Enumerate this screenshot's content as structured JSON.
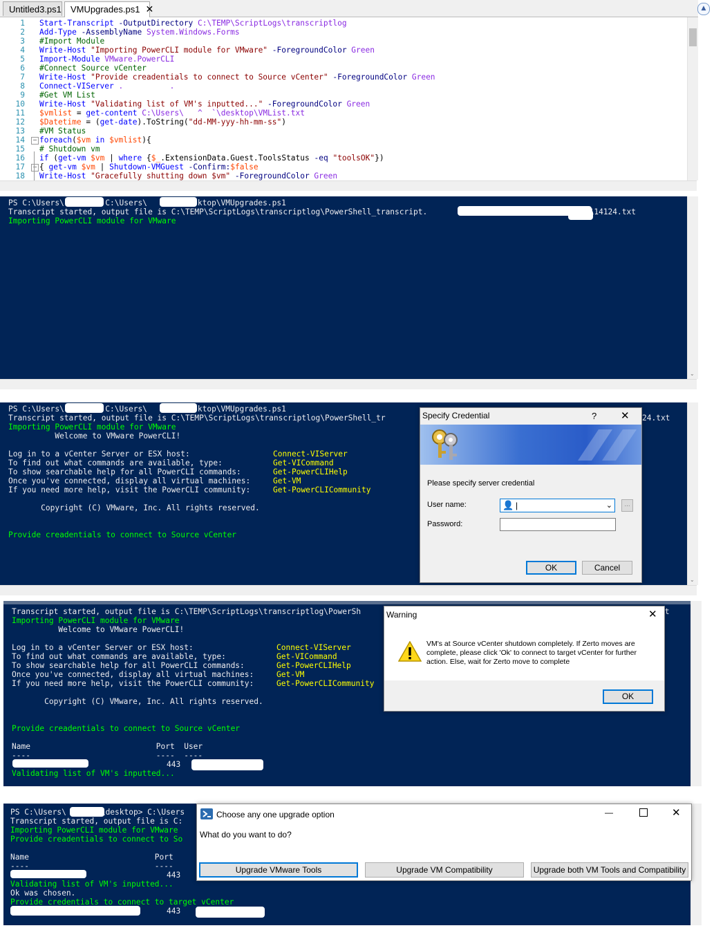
{
  "editor": {
    "tabs": [
      {
        "label": "Untitled3.ps1"
      },
      {
        "label": "VMUpgrades.ps1",
        "close": "✕"
      }
    ],
    "lines": [
      {
        "n": "1",
        "parts": [
          [
            "c",
            "Start-Transcript"
          ],
          [
            "p",
            " -OutputDirectory "
          ],
          [
            "a",
            "C:\\TEMP\\ScriptLogs\\transcriptlog"
          ]
        ]
      },
      {
        "n": "2",
        "parts": [
          [
            "c",
            "Add-Type"
          ],
          [
            "p",
            " -AssemblyName "
          ],
          [
            "a",
            "System.Windows.Forms"
          ]
        ]
      },
      {
        "n": "3",
        "parts": [
          [
            "m",
            "#Import Module"
          ]
        ]
      },
      {
        "n": "4",
        "parts": [
          [
            "c",
            "Write-Host"
          ],
          [
            "s",
            " \"Importing PowerCLI module for VMware\""
          ],
          [
            "p",
            " -ForegroundColor "
          ],
          [
            "a",
            "Green"
          ]
        ]
      },
      {
        "n": "5",
        "parts": [
          [
            "c",
            "Import-Module"
          ],
          [
            "a",
            " VMware.PowerCLI"
          ]
        ]
      },
      {
        "n": "6",
        "parts": [
          [
            "m",
            "#Connect Source vCenter"
          ]
        ]
      },
      {
        "n": "7",
        "parts": [
          [
            "c",
            "Write-Host"
          ],
          [
            "s",
            " \"Provide creadentials to connect to Source vCenter\""
          ],
          [
            "p",
            " -ForegroundColor "
          ],
          [
            "a",
            "Green"
          ]
        ]
      },
      {
        "n": "8",
        "parts": [
          [
            "c",
            "Connect-VIServer"
          ],
          [
            "a",
            " .          ."
          ]
        ]
      },
      {
        "n": "9",
        "parts": [
          [
            "m",
            "#Get VM List"
          ]
        ]
      },
      {
        "n": "10",
        "parts": [
          [
            "c",
            "Write-Host"
          ],
          [
            "s",
            " \"Validating list of VM's inputted...\""
          ],
          [
            "p",
            " -ForegroundColor "
          ],
          [
            "a",
            "Green"
          ]
        ]
      },
      {
        "n": "11",
        "parts": [
          [
            "v",
            "$vmlist"
          ],
          [
            "t",
            " = "
          ],
          [
            "c",
            "get-content"
          ],
          [
            "a",
            " C:\\Users\\   ^  `\\desktop\\VMList.txt"
          ]
        ]
      },
      {
        "n": "12",
        "parts": [
          [
            "v",
            "$Datetime"
          ],
          [
            "t",
            " = ("
          ],
          [
            "c",
            "get-date"
          ],
          [
            "t",
            ").ToString("
          ],
          [
            "s",
            "\"dd-MM-yyy-hh-mm-ss\""
          ],
          [
            "t",
            ")"
          ]
        ]
      },
      {
        "n": "13",
        "parts": [
          [
            "m",
            "#VM Status"
          ]
        ]
      },
      {
        "n": "14",
        "parts": [
          [
            "c",
            "foreach"
          ],
          [
            "t",
            "("
          ],
          [
            "v",
            "$vm"
          ],
          [
            "c",
            " in "
          ],
          [
            "v",
            "$vmlist"
          ],
          [
            "t",
            "){"
          ]
        ]
      },
      {
        "n": "15",
        "parts": [
          [
            "m",
            "# Shutdown vm"
          ]
        ]
      },
      {
        "n": "16",
        "parts": [
          [
            "c",
            "if"
          ],
          [
            "t",
            " ("
          ],
          [
            "c",
            "get-vm"
          ],
          [
            "v",
            " $vm"
          ],
          [
            "t",
            " | "
          ],
          [
            "c",
            "where"
          ],
          [
            "t",
            " {"
          ],
          [
            "v",
            "$_"
          ],
          [
            "t",
            ".ExtensionData.Guest.ToolsStatus "
          ],
          [
            "p",
            "-eq"
          ],
          [
            "s",
            " \"toolsOK\""
          ],
          [
            "t",
            "})"
          ]
        ]
      },
      {
        "n": "17",
        "parts": [
          [
            "t",
            "{ "
          ],
          [
            "c",
            "get-vm"
          ],
          [
            "v",
            " $vm"
          ],
          [
            "t",
            " | "
          ],
          [
            "c",
            "Shutdown-VMGuest"
          ],
          [
            "p",
            " -Confirm:"
          ],
          [
            "v",
            "$false"
          ]
        ]
      },
      {
        "n": "18",
        "parts": [
          [
            "c",
            "Write-Host"
          ],
          [
            "s",
            " \"Gracefully shutting down $vm\""
          ],
          [
            "p",
            " -ForegroundColor "
          ],
          [
            "a",
            "Green"
          ]
        ]
      }
    ]
  },
  "console1": {
    "l1_a": "PS C:\\Users\\",
    "l1_b": "> C:\\Users\\",
    "l1_c": "\\Desktop\\VMUpgrades.ps1",
    "l2_a": "Transcript started, output file is C:\\TEMP\\ScriptLogs\\transcriptlog\\PowerShell_transcript.",
    "l2_b": "240118114124.txt",
    "l3": "Importing PowerCLI module for VMware"
  },
  "console2": {
    "l1_a": "PS C:\\Users\\",
    "l1_b": "> C:\\Users\\",
    "l1_c": "\\Desktop\\VMUpgrades.ps1",
    "l2": "Transcript started, output file is C:\\TEMP\\ScriptLogs\\transcriptlog\\PowerShell_tr",
    "l2_tail": "24.txt",
    "l3": "Importing PowerCLI module for VMware",
    "welcome": "          Welcome to VMware PowerCLI!",
    "help": [
      {
        "text": "Log in to a vCenter Server or ESX host:          ",
        "cmd": "Connect-VIServer"
      },
      {
        "text": "To find out what commands are available, type:   ",
        "cmd": "Get-VICommand"
      },
      {
        "text": "To show searchable help for all PowerCLI commands: ",
        "cmd": "Get-PowerCLIHelp"
      },
      {
        "text": "Once you've connected, display all virtual machines: ",
        "cmd": "Get-VM"
      },
      {
        "text": "If you need more help, visit the PowerCLI community: ",
        "cmd": "Get-PowerCLICommunity"
      }
    ],
    "copyright": "       Copyright (C) VMware, Inc. All rights reserved.",
    "provide": "Provide creadentials to connect to Source vCenter"
  },
  "credential_dialog": {
    "title": "Specify Credential",
    "help": "?",
    "close": "✕",
    "prompt": "Please specify server credential",
    "user_label": "User name:",
    "password_label": "Password:",
    "browse": "...",
    "ok": "OK",
    "cancel": "Cancel"
  },
  "console3": {
    "l2": "Transcript started, output file is C:\\TEMP\\ScriptLogs\\transcriptlog\\PowerSh",
    "l2_tail": "xt",
    "l3": "Importing PowerCLI module for VMware",
    "welcome": "          Welcome to VMware PowerCLI!",
    "copyright": "       Copyright (C) VMware, Inc. All rights reserved.",
    "provide": "Provide creadentials to connect to Source vCenter",
    "hdr": "Name                           Port  User",
    "sep": "----                           ----  ----",
    "port": "443",
    "validating": "Validating list of VM's inputted..."
  },
  "warning_dialog": {
    "title": "Warning",
    "close": "✕",
    "message": "VM's at Source vCenter shutdown completely. If Zerto moves are complete, please click 'Ok' to connect to target vCenter for further action. Else, wait for Zerto move to complete",
    "ok": "OK"
  },
  "console4": {
    "l1_a": "PS C:\\Users\\",
    "l1_b": "\\desktop> C:\\Users",
    "l2": "Transcript started, output file is C:",
    "l3": "Importing PowerCLI module for VMware",
    "l4": "Provide creadentials to connect to So",
    "hdr": "Name                           Port",
    "sep": "----                           ----",
    "port": "443",
    "validating": "Validating list of VM's inputted...",
    "ok_chosen": "Ok was chosen.",
    "provide_target": "Provide credentials to connect to target vCenter",
    "port2": "443"
  },
  "upgrade_dialog": {
    "title": "Choose any one upgrade option",
    "question": "What do you want to do?",
    "minimize": "—",
    "close": "✕",
    "buttons": [
      "Upgrade VMware Tools",
      "Upgrade VM Compatibility",
      "Upgrade both VM Tools and Compatibility"
    ]
  },
  "colors": {
    "console_bg": "#012456",
    "console_green": "#00ff00",
    "console_yellow": "#ffff00",
    "accent": "#0078d7"
  }
}
